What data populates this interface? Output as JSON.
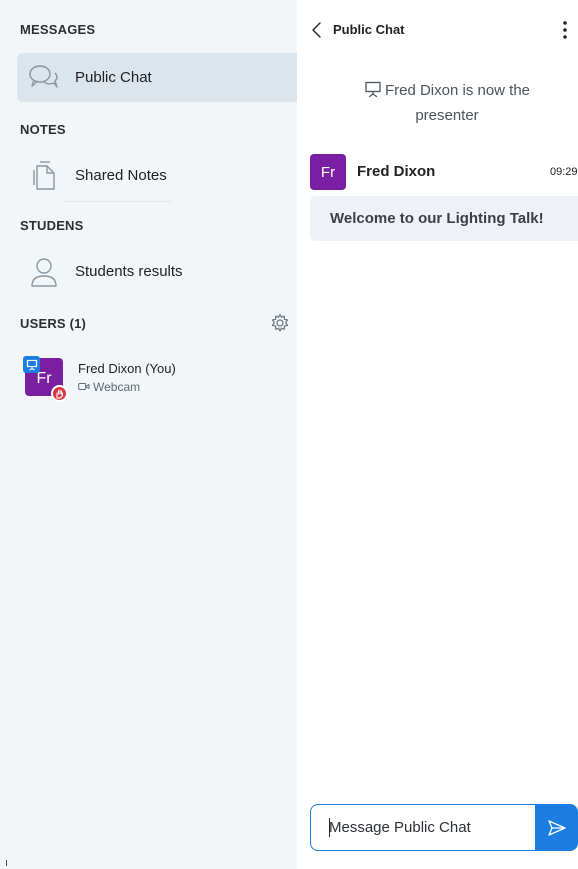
{
  "sidebar": {
    "messages_title": "MESSAGES",
    "public_chat_label": "Public Chat",
    "notes_title": "NOTES",
    "shared_notes_label": "Shared Notes",
    "students_title": "STUDENS",
    "students_results_label": "Students results",
    "users_title": "USERS (1)",
    "user": {
      "name": "Fred Dixon (You)",
      "initials": "Fr",
      "status": "Webcam"
    }
  },
  "chat": {
    "title": "Public Chat",
    "system_message": "Fred Dixon is now the presenter",
    "message": {
      "author_initials": "Fr",
      "author": "Fred Dixon",
      "time": "09:29",
      "text": "Welcome to our Lighting Talk!"
    },
    "input_placeholder": "Message Public Chat"
  },
  "icons": {
    "back": "chevron-left-icon",
    "more": "vertical-dots-icon",
    "presenter": "presentation-icon",
    "gear": "gear-icon",
    "send": "send-icon",
    "chat": "chat-bubbles-icon",
    "notes": "document-icon",
    "user": "user-icon"
  },
  "colors": {
    "accent": "#1b7de0",
    "avatar": "#7b1fa2",
    "sidebar_bg": "#f3f6f9",
    "active_item": "#dce4ec",
    "raise_hand": "#d9363e"
  }
}
